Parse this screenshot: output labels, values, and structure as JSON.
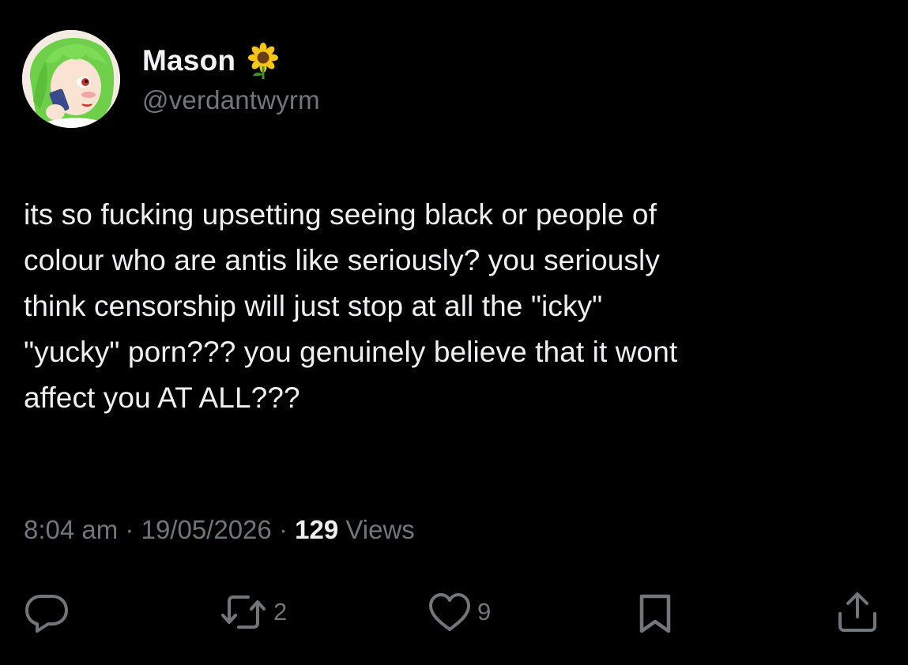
{
  "author": {
    "display_name": "Mason",
    "badge_emoji": "sunflower-icon",
    "handle": "@verdantwyrm",
    "avatar_icon": "avatar-illustration"
  },
  "tweet": {
    "text": "its so fucking upsetting seeing black or people of\ncolour who are antis like seriously? you seriously\nthink censorship will just stop at all the \"icky\"\n\"yucky\" porn??? you genuinely believe that it wont\naffect you AT ALL???",
    "time": "8:04 am",
    "separator": "·",
    "date": "19/05/2026",
    "views_count": "129",
    "views_label": "Views"
  },
  "actions": {
    "reply_icon": "reply-icon",
    "retweet_icon": "retweet-icon",
    "retweet_count": "2",
    "like_icon": "heart-icon",
    "like_count": "9",
    "bookmark_icon": "bookmark-icon",
    "share_icon": "share-icon"
  },
  "colors": {
    "background": "#000000",
    "text_primary": "#eef0f1",
    "text_secondary": "#71767b"
  }
}
